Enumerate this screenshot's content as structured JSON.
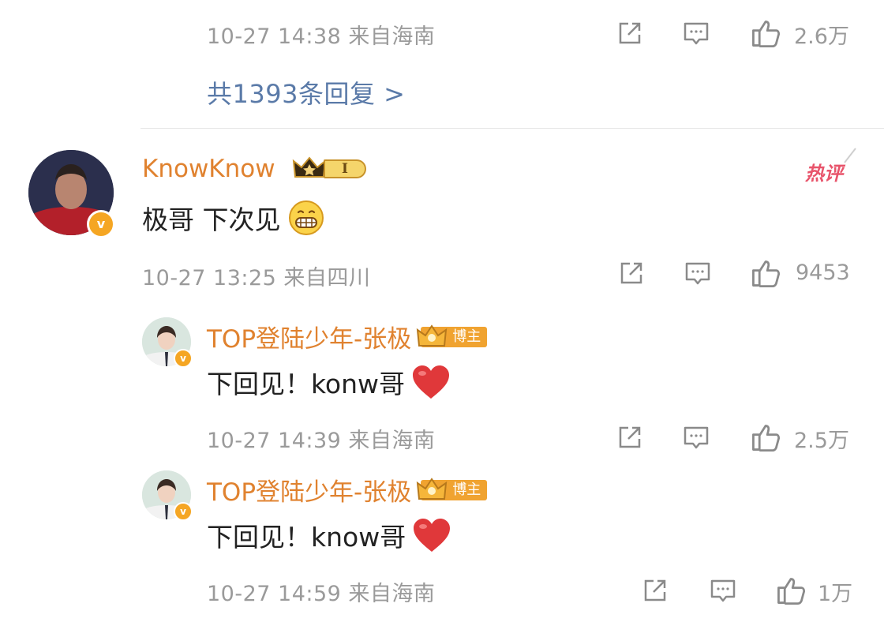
{
  "top_comment": {
    "meta": "10-27 14:38 来自海南",
    "likes": "2.6万",
    "more_replies": "共1393条回复 >"
  },
  "comment": {
    "username": "KnowKnow",
    "level_badge": "I",
    "hot_tag": "热评",
    "text": "极哥 下次见",
    "meta": "10-27 13:25 来自四川",
    "likes": "9453"
  },
  "replies": [
    {
      "username": "TOP登陆少年-张极",
      "badge": "博主",
      "text": "下回见！konw哥",
      "meta": "10-27 14:39 来自海南",
      "likes": "2.5万"
    },
    {
      "username": "TOP登陆少年-张极",
      "badge": "博主",
      "text": "下回见！know哥",
      "meta": "10-27 14:59 来自海南",
      "likes": "1万"
    }
  ],
  "icons": {
    "share": "share-icon",
    "comment": "comment-icon",
    "like": "like-icon",
    "emoji_grin": "grin-emoji-icon",
    "heart": "heart-emoji-icon",
    "crown": "crown-icon",
    "verified": "verified-v-icon"
  },
  "colors": {
    "username": "#e0822f",
    "meta": "#9a9a9a",
    "link": "#5a7aa8",
    "hot": "#e8546b",
    "heart": "#e0383a",
    "badge": "#f0a330"
  }
}
